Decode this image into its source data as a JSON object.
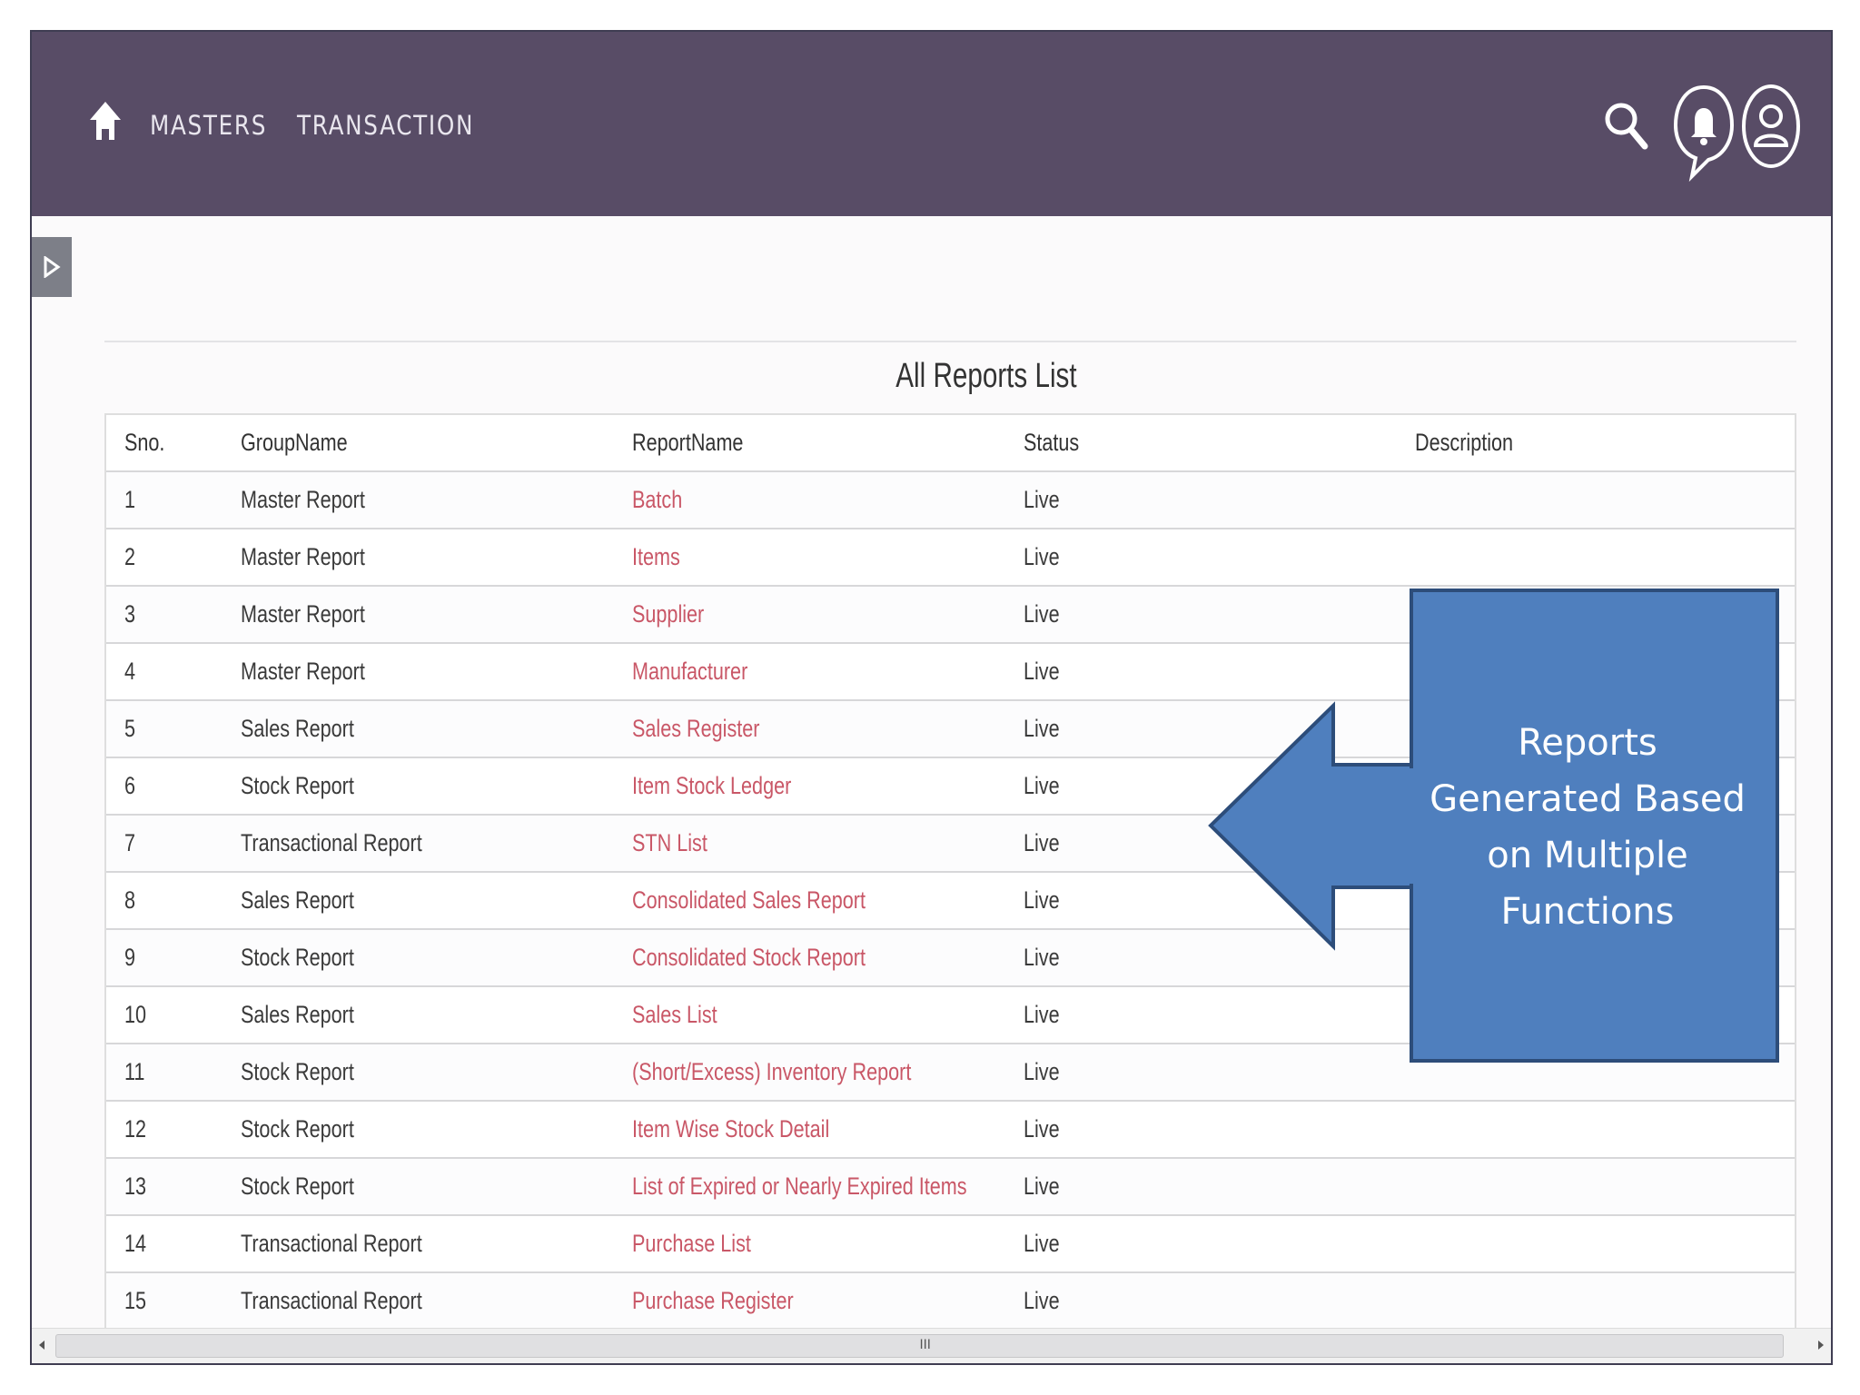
{
  "header": {
    "nav": [
      "MASTERS",
      "TRANSACTION"
    ],
    "icons": [
      "home-icon",
      "search-icon",
      "bell-icon",
      "user-icon"
    ],
    "background_color": "#584c66"
  },
  "table": {
    "title": "All Reports List",
    "columns": [
      "Sno.",
      "GroupName",
      "ReportName",
      "Status",
      "Description"
    ],
    "rows": [
      [
        "1",
        "Master Report",
        "Batch",
        "Live",
        ""
      ],
      [
        "2",
        "Master Report",
        "Items",
        "Live",
        ""
      ],
      [
        "3",
        "Master Report",
        "Supplier",
        "Live",
        ""
      ],
      [
        "4",
        "Master Report",
        "Manufacturer",
        "Live",
        ""
      ],
      [
        "5",
        "Sales Report",
        "Sales Register",
        "Live",
        ""
      ],
      [
        "6",
        "Stock Report",
        "Item Stock Ledger",
        "Live",
        ""
      ],
      [
        "7",
        "Transactional Report",
        "STN List",
        "Live",
        ""
      ],
      [
        "8",
        "Sales Report",
        "Consolidated Sales Report",
        "Live",
        ""
      ],
      [
        "9",
        "Stock Report",
        "Consolidated Stock Report",
        "Live",
        ""
      ],
      [
        "10",
        "Sales Report",
        "Sales List",
        "Live",
        ""
      ],
      [
        "11",
        "Stock Report",
        "(Short/Excess) Inventory Report",
        "Live",
        ""
      ],
      [
        "12",
        "Stock Report",
        "Item Wise Stock Detail",
        "Live",
        ""
      ],
      [
        "13",
        "Stock Report",
        "List of Expired or Nearly Expired Items",
        "Live",
        ""
      ],
      [
        "14",
        "Transactional Report",
        "Purchase List",
        "Live",
        ""
      ],
      [
        "15",
        "Transactional Report",
        "Purchase Register",
        "Live",
        ""
      ]
    ],
    "link_color": "#c95767"
  },
  "callout": {
    "text": "Reports\nGenerated Based\non Multiple\nFunctions",
    "fill_color": "#4f7fbe",
    "border_color": "#2d4d7a"
  },
  "scrollbar": {
    "grip": "III"
  }
}
